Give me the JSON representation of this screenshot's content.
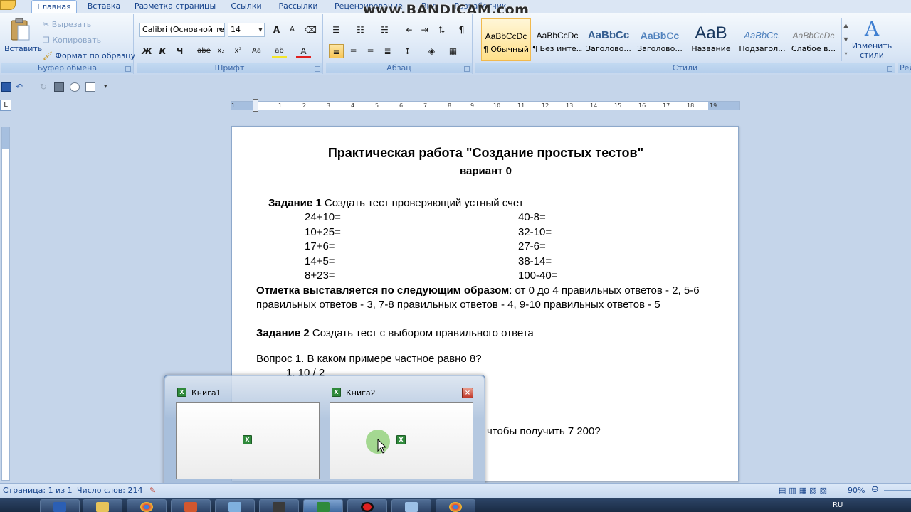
{
  "watermark": "www.BANDICAM.com",
  "tabs": [
    {
      "label": "Главная",
      "active": true
    },
    {
      "label": "Вставка"
    },
    {
      "label": "Разметка страницы"
    },
    {
      "label": "Ссылки"
    },
    {
      "label": "Рассылки"
    },
    {
      "label": "Рецензирование"
    },
    {
      "label": "Вид"
    },
    {
      "label": "Разработчик"
    }
  ],
  "clipboard": {
    "paste": "Вставить",
    "cut": "Вырезать",
    "copy": "Копировать",
    "format_painter": "Формат по образцу",
    "label": "Буфер обмена"
  },
  "font": {
    "family": "Calibri (Основной те",
    "size": "14",
    "grow": "A",
    "shrink": "A",
    "bold": "Ж",
    "italic": "К",
    "underline": "Ч",
    "strike": "abe",
    "subscript": "x₂",
    "superscript": "x²",
    "case": "Aa",
    "highlight": "ab",
    "color": "A",
    "label": "Шрифт",
    "color_accent": "#e02020",
    "highlight_accent": "#f3e52b"
  },
  "paragraph": {
    "label": "Абзац",
    "show_marks": "¶"
  },
  "styles": {
    "items": [
      {
        "sample": "AaBbCcDc",
        "name": "¶ Обычный",
        "selected": true
      },
      {
        "sample": "AaBbCcDc",
        "name": "¶ Без инте..."
      },
      {
        "sample": "AaBbCc",
        "name": "Заголово..."
      },
      {
        "sample": "AaBbCc",
        "name": "Заголово..."
      },
      {
        "sample": "AaB",
        "name": "Название"
      },
      {
        "sample": "AaBbCc.",
        "name": "Подзагол..."
      },
      {
        "sample": "AaBbCcDc",
        "name": "Слабое в..."
      }
    ],
    "change": "Изменить стили",
    "label": "Стили"
  },
  "editing_label_partial": "Ред",
  "ruler": {
    "corner": "L",
    "ticks": [
      "1",
      "1",
      "2",
      "3",
      "4",
      "5",
      "6",
      "7",
      "8",
      "9",
      "10",
      "11",
      "12",
      "13",
      "14",
      "15",
      "16",
      "17",
      "18",
      "19"
    ]
  },
  "document": {
    "title": "Практическая работа \"Создание простых тестов\"",
    "subtitle": "вариант 0",
    "task1_label": "Задание 1",
    "task1_text": "  Создать тест проверяющий устный счет",
    "col1": [
      "24+10=",
      "10+25=",
      "17+6=",
      "14+5=",
      "8+23="
    ],
    "col2": [
      "40-8=",
      "32-10=",
      "27-6=",
      "38-14=",
      "100-40="
    ],
    "grading_bold": "Отметка выставляется по следующим образом",
    "grading_rest": ": от 0 до 4 правильных ответов - 2, 5-6",
    "grading_line2": "правильных ответов - 3, 7-8 правильных ответов - 4, 9-10 правильных ответов - 5",
    "task2_label": "Задание 2",
    "task2_text": "  Создать тест с выбором правильного ответа",
    "question1": "Вопрос 1. В каком примере частное равно 8?",
    "answer1": "1.   10 / 2",
    "question_partial": "чтобы получить 7 200?"
  },
  "popup": {
    "windows": [
      {
        "title": "Книга1"
      },
      {
        "title": "Книга2"
      }
    ],
    "close": "×"
  },
  "status": {
    "page": "Страница: 1 из 1",
    "words": "Число слов: 214",
    "zoom": "90%"
  },
  "taskbar": {
    "lang": "RU"
  }
}
